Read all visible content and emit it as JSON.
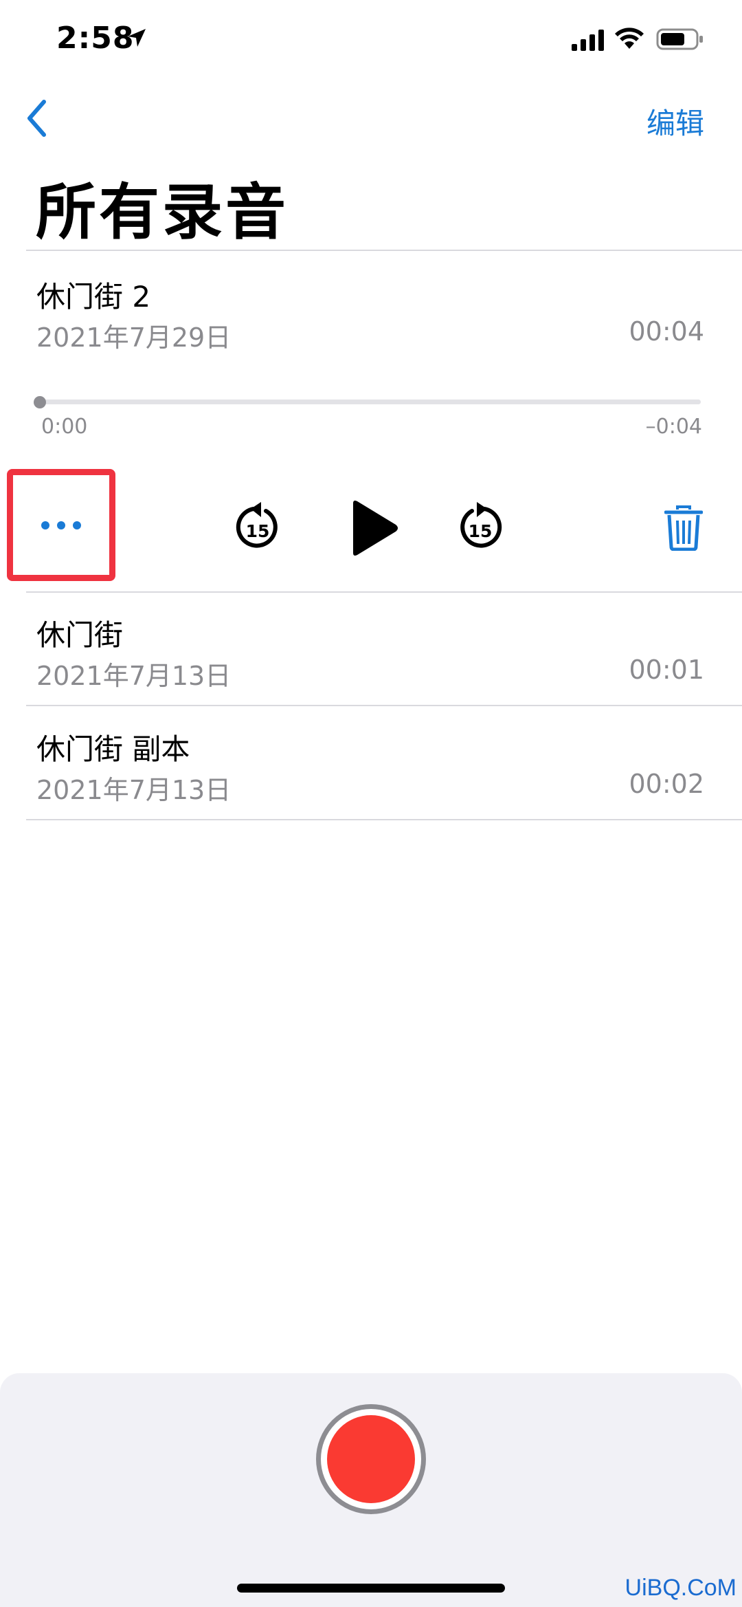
{
  "status_bar": {
    "time": "2:58"
  },
  "nav": {
    "back_icon": "chevron-left-icon",
    "edit_label": "编辑"
  },
  "page_title": "所有录音",
  "expanded_recording": {
    "title": "休门街 2",
    "date": "2021年7月29日",
    "duration": "00:04",
    "elapsed": "0:00",
    "remaining": "–0:04",
    "progress": 0.0
  },
  "controls": {
    "more_icon": "ellipsis-icon",
    "skip_back_label": "15",
    "play_icon": "play-icon",
    "skip_forward_label": "15",
    "delete_icon": "trash-icon"
  },
  "recordings": [
    {
      "title": "休门街",
      "date": "2021年7月13日",
      "duration": "00:01"
    },
    {
      "title": "休门街 副本",
      "date": "2021年7月13日",
      "duration": "00:02"
    }
  ],
  "colors": {
    "accent": "#1a7bd6",
    "record": "#fa3a32",
    "highlight": "#ef3340",
    "secondary_text": "#8a8a8e"
  },
  "watermark": "UiBQ.CoM"
}
